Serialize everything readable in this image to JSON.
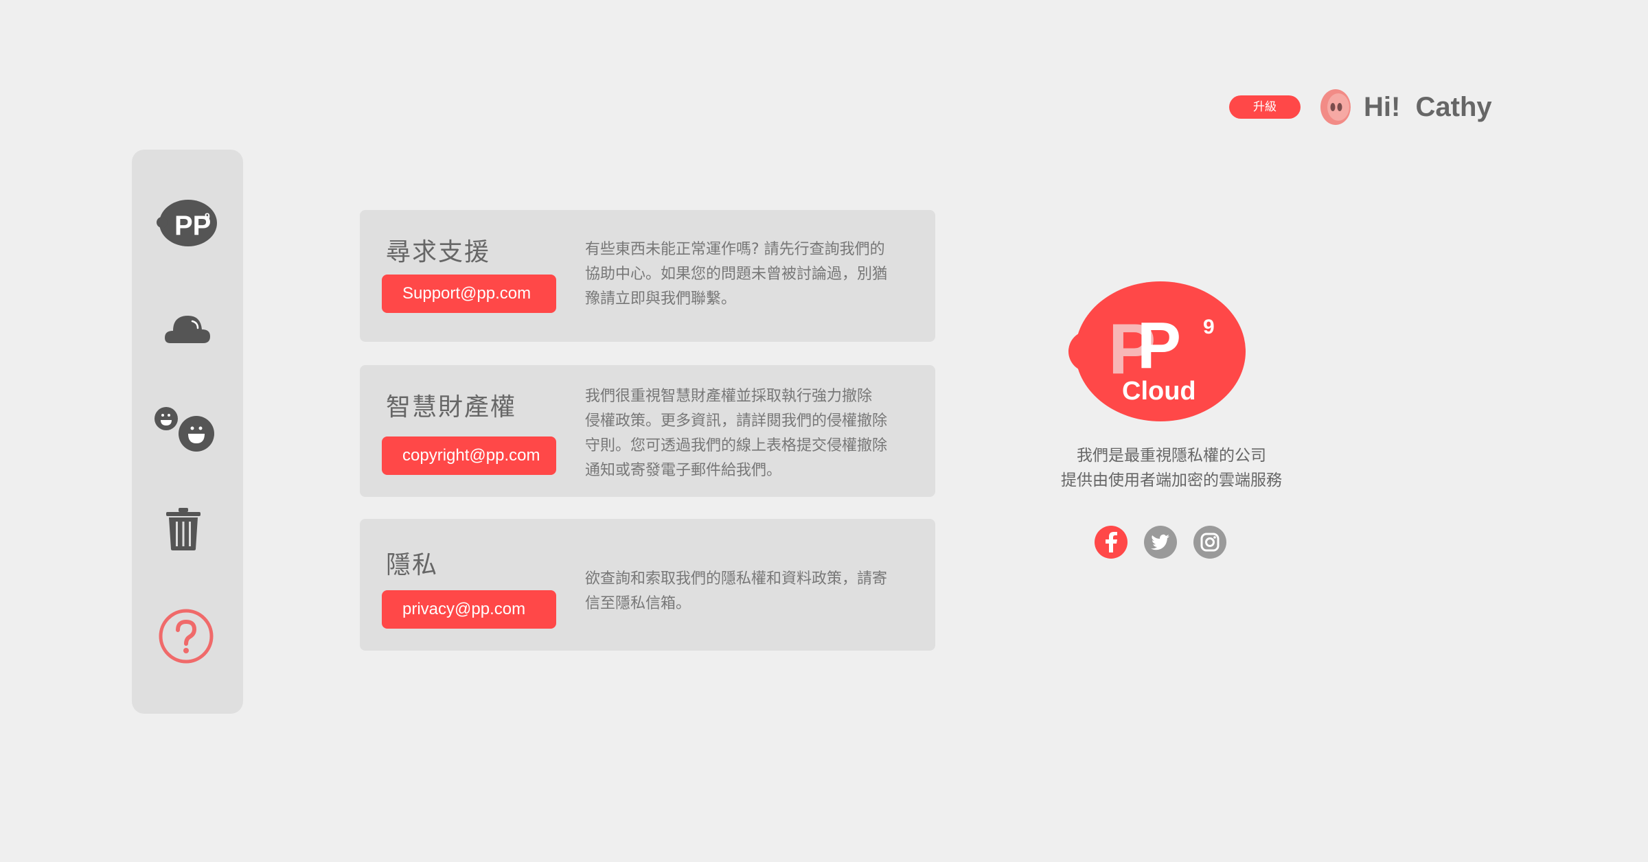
{
  "header": {
    "upgrade_label": "升級",
    "greeting": "Hi!  Cathy"
  },
  "sidebar": {
    "items": [
      {
        "icon": "pp-logo-icon"
      },
      {
        "icon": "cloud-icon"
      },
      {
        "icon": "share-faces-icon"
      },
      {
        "icon": "trash-icon"
      },
      {
        "icon": "help-icon",
        "active": true
      }
    ]
  },
  "cards": [
    {
      "title": "尋求支援",
      "email": "Support@pp.com",
      "lines": [
        "有些東西未能正常運作嗎? 請先行查詢我們的",
        "協助中心。如果您的問題未曾被討論過，別猶",
        "豫請立即與我們聯繫。"
      ]
    },
    {
      "title": "智慧財產權",
      "email": "copyright@pp.com",
      "lines": [
        "我們很重視智慧財產權並採取執行強力撤除",
        "侵權政策。更多資訊，請詳閱我們的侵權撤除",
        "守則。您可透過我們的線上表格提交侵權撤除",
        "通知或寄發電子郵件給我們。"
      ]
    },
    {
      "title": "隱私",
      "email": "privacy@pp.com",
      "lines": [
        "欲查詢和索取我們的隱私權和資料政策，請寄",
        "信至隱私信箱。"
      ]
    }
  ],
  "brand": {
    "logo_text": "Cloud",
    "tagline": [
      "我們是最重視隱私權的公司",
      "提供由使用者端加密的雲端服務"
    ]
  },
  "social": [
    {
      "icon": "facebook-icon",
      "color": "#ff4848"
    },
    {
      "icon": "twitter-icon",
      "color": "#9a9a9a"
    },
    {
      "icon": "instagram-icon",
      "color": "#9a9a9a"
    }
  ],
  "colors": {
    "accent": "#ff4848",
    "background": "#efefef",
    "panel": "#dfdfdf",
    "icon_dark": "#555555",
    "avatar": "#f28b86"
  }
}
